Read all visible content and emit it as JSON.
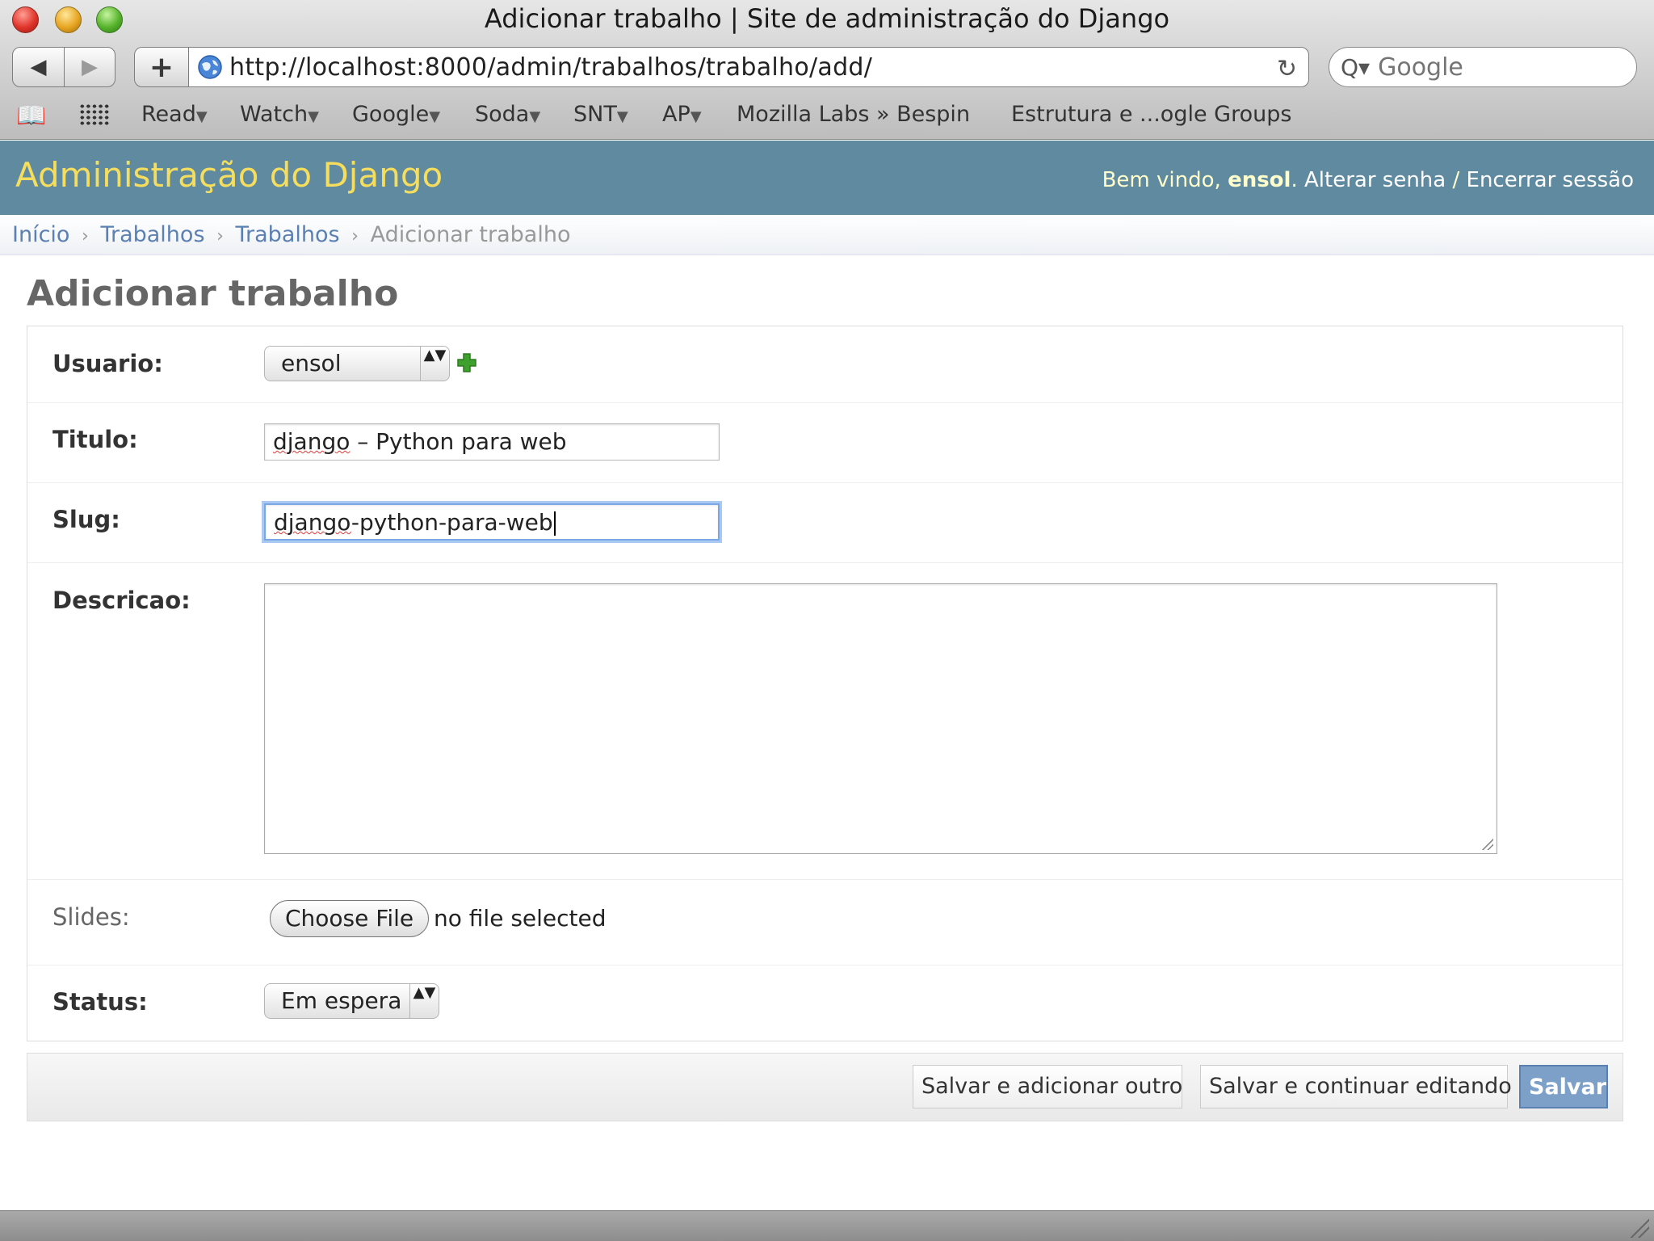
{
  "browser": {
    "window_title": "Adicionar trabalho | Site de administração do Django",
    "back_icon": "◀",
    "forward_icon": "▶",
    "add_icon": "+",
    "url": "http://localhost:8000/admin/trabalhos/trabalho/add/",
    "reload_icon": "↻",
    "search_icon": "Q▾",
    "search_placeholder": "Google",
    "book_icon": "📖",
    "bookmarks": [
      {
        "label": "Read",
        "caret": "▼"
      },
      {
        "label": "Watch",
        "caret": "▼"
      },
      {
        "label": "Google",
        "caret": "▼"
      },
      {
        "label": "Soda",
        "caret": "▼"
      },
      {
        "label": "SNT",
        "caret": "▼"
      },
      {
        "label": "AP",
        "caret": "▼"
      },
      {
        "label": "Mozilla Labs » Bespin"
      },
      {
        "label": "Estrutura e ...ogle Groups"
      }
    ]
  },
  "header": {
    "site_title": "Administração do Django",
    "welcome": "Bem vindo, ",
    "username": "ensol",
    "period": ". ",
    "change_password": "Alterar senha",
    "separator": " / ",
    "logout": "Encerrar sessão"
  },
  "breadcrumbs": {
    "home": "Início",
    "sep": "›",
    "app": "Trabalhos",
    "model": "Trabalhos",
    "current": "Adicionar trabalho"
  },
  "page": {
    "title": "Adicionar trabalho"
  },
  "form": {
    "usuario": {
      "label": "Usuario:",
      "value": "ensol",
      "arrows": "▲▼"
    },
    "titulo": {
      "label": "Titulo:",
      "value_word": "django",
      "value_rest": " – Python para web"
    },
    "slug": {
      "label": "Slug:",
      "value_word": "django",
      "value_rest": "-python-para-web"
    },
    "descricao": {
      "label": "Descricao:",
      "value": ""
    },
    "slides": {
      "label": "Slides:",
      "button": "Choose File",
      "file_status": "no file selected"
    },
    "status": {
      "label": "Status:",
      "value": "Em espera",
      "arrows": "▲▼"
    }
  },
  "submit": {
    "save_add": "Salvar e adicionar outro",
    "save_continue": "Salvar e continuar editando",
    "save": "Salvar"
  },
  "colors": {
    "header_bg": "#5f8aa0",
    "site_title": "#f5dd5d",
    "link": "#5b80b2",
    "add_icon": "#3ea12d",
    "save_button": "#7ca0c7"
  }
}
